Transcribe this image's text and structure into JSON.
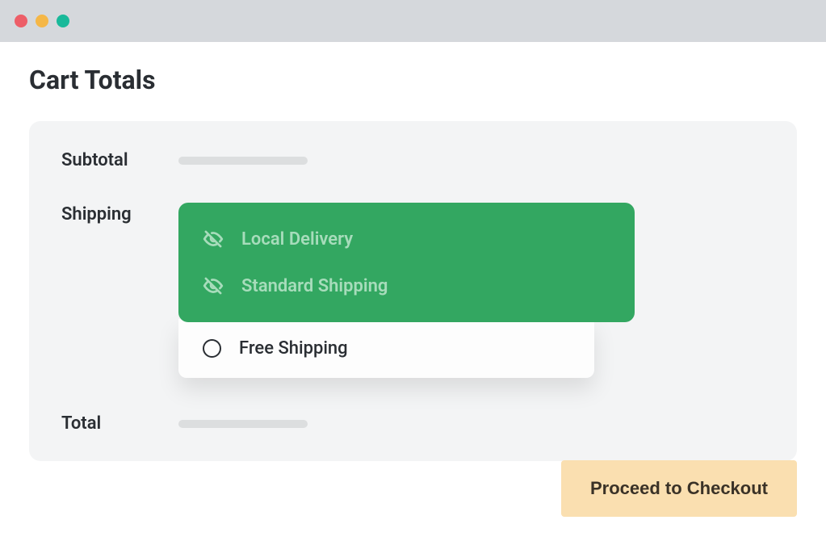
{
  "window": {
    "dots": [
      "red",
      "yellow",
      "green"
    ]
  },
  "page": {
    "title": "Cart Totals"
  },
  "totals": {
    "subtotal_label": "Subtotal",
    "shipping_label": "Shipping",
    "total_label": "Total"
  },
  "shipping": {
    "hidden_options": [
      {
        "label": "Local Delivery"
      },
      {
        "label": "Standard Shipping"
      }
    ],
    "visible_options": [
      {
        "label": "Free Shipping"
      }
    ]
  },
  "actions": {
    "checkout_label": "Proceed to Checkout"
  }
}
